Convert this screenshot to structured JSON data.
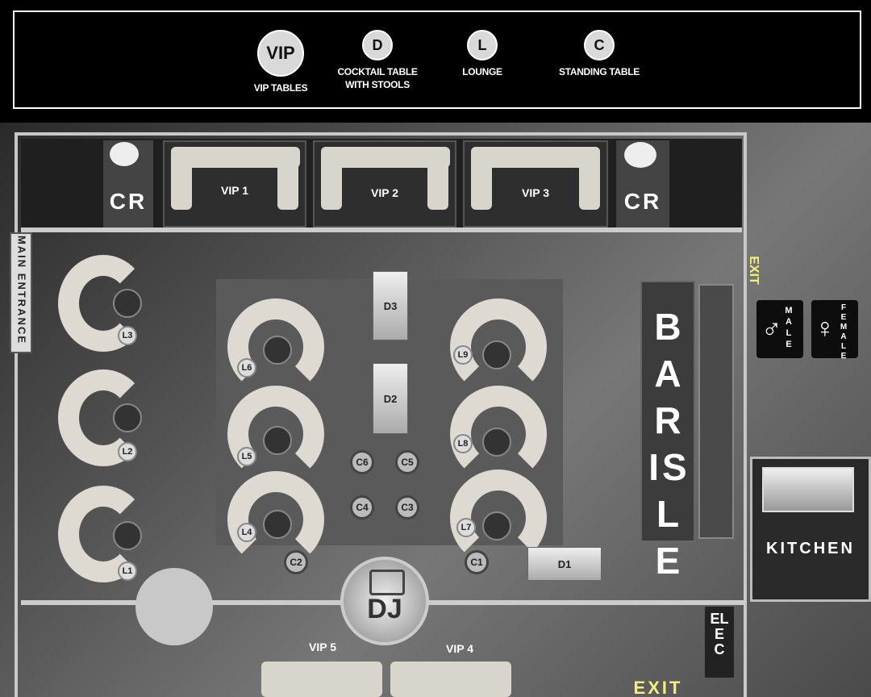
{
  "legend": {
    "items": [
      {
        "symbol": "VIP",
        "label": "VIP TABLES"
      },
      {
        "symbol": "D",
        "label": "COCKTAIL TABLE\nWITH STOOLS"
      },
      {
        "symbol": "L",
        "label": "LOUNGE"
      },
      {
        "symbol": "C",
        "label": "STANDING TABLE"
      }
    ]
  },
  "rooms": {
    "cr_left": "CR",
    "cr_right": "CR",
    "main_entrance": "MAIN ENTRANCE",
    "exit_top": "EXIT",
    "exit_bottom": "EXIT",
    "male": "MALE",
    "female": "FEMALE",
    "bar": "BAR ISLE",
    "kitchen": "KITCHEN",
    "elec": "ELEC",
    "dj": "DJ"
  },
  "vip": [
    "VIP 1",
    "VIP 2",
    "VIP 3",
    "VIP 5",
    "VIP 4"
  ],
  "lounges": [
    "L1",
    "L2",
    "L3",
    "L4",
    "L5",
    "L6",
    "L7",
    "L8",
    "L9"
  ],
  "cocktail": [
    "D1",
    "D2",
    "D3"
  ],
  "standing": [
    "C1",
    "C2",
    "C3",
    "C4",
    "C5",
    "C6"
  ]
}
